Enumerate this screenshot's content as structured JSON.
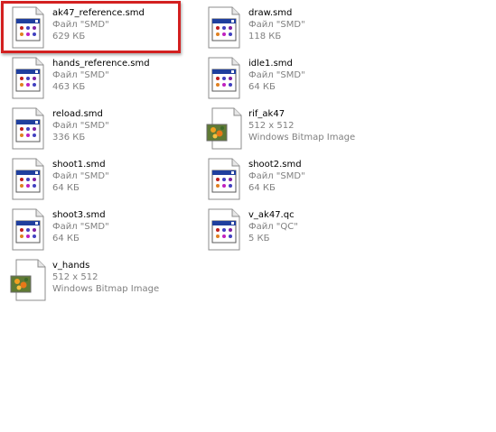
{
  "window": {
    "view": "Tiles"
  },
  "selection": {
    "highlighted_item": "ak47_reference.smd",
    "highlight_color": "#d32020"
  },
  "files": [
    {
      "name": "ak47_reference.smd",
      "type": "Файл \"SMD\"",
      "size": "629 КБ",
      "icon": "document-icon"
    },
    {
      "name": "draw.smd",
      "type": "Файл \"SMD\"",
      "size": "118 КБ",
      "icon": "document-icon"
    },
    {
      "name": "hands_reference.smd",
      "type": "Файл \"SMD\"",
      "size": "463 КБ",
      "icon": "document-icon"
    },
    {
      "name": "idle1.smd",
      "type": "Файл \"SMD\"",
      "size": "64 КБ",
      "icon": "document-icon"
    },
    {
      "name": "reload.smd",
      "type": "Файл \"SMD\"",
      "size": "336 КБ",
      "icon": "document-icon"
    },
    {
      "name": "rif_ak47",
      "type": "512 x 512",
      "size": "Windows Bitmap Image",
      "icon": "bitmap-image-icon"
    },
    {
      "name": "shoot1.smd",
      "type": "Файл \"SMD\"",
      "size": "64 КБ",
      "icon": "document-icon"
    },
    {
      "name": "shoot2.smd",
      "type": "Файл \"SMD\"",
      "size": "64 КБ",
      "icon": "document-icon"
    },
    {
      "name": "shoot3.smd",
      "type": "Файл \"SMD\"",
      "size": "64 КБ",
      "icon": "document-icon"
    },
    {
      "name": "v_ak47.qc",
      "type": "Файл \"QC\"",
      "size": "5 КБ",
      "icon": "document-icon"
    },
    {
      "name": "v_hands",
      "type": "512 x 512",
      "size": "Windows Bitmap Image",
      "icon": "bitmap-image-icon"
    }
  ]
}
